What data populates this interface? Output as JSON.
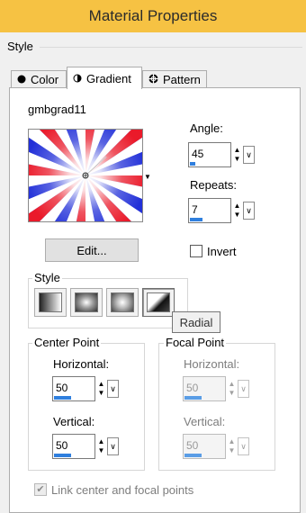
{
  "window": {
    "title": "Material Properties"
  },
  "section_label": "Style",
  "tabs": [
    {
      "label": "Color",
      "icon": "filled-circle-icon",
      "active": false
    },
    {
      "label": "Gradient",
      "icon": "half-circle-icon",
      "active": true
    },
    {
      "label": "Pattern",
      "icon": "pattern-grid-icon",
      "active": false
    }
  ],
  "gradient": {
    "name": "gmbgrad11",
    "colors": {
      "red": "#ea1a2a",
      "white": "#ffffff",
      "blue": "#2230d8"
    },
    "edit_label": "Edit..."
  },
  "angle": {
    "label": "Angle:",
    "value": "45",
    "level_fraction": 0.13
  },
  "repeats": {
    "label": "Repeats:",
    "value": "7",
    "level_fraction": 0.3
  },
  "invert": {
    "label": "Invert",
    "checked": false
  },
  "style": {
    "label": "Style",
    "buttons": [
      "linear",
      "rectangular",
      "sunburst",
      "radial"
    ],
    "selected": "radial",
    "tooltip": "Radial"
  },
  "center_point": {
    "title": "Center Point",
    "horizontal_label": "Horizontal:",
    "horizontal_value": "50",
    "vertical_label": "Vertical:",
    "vertical_value": "50",
    "level_fraction": 0.5
  },
  "focal_point": {
    "title": "Focal Point",
    "horizontal_label": "Horizontal:",
    "horizontal_value": "50",
    "vertical_label": "Vertical:",
    "vertical_value": "50",
    "disabled": true,
    "level_fraction": 0.5
  },
  "link": {
    "label": "Link center and focal points",
    "checked": true,
    "disabled": true
  }
}
